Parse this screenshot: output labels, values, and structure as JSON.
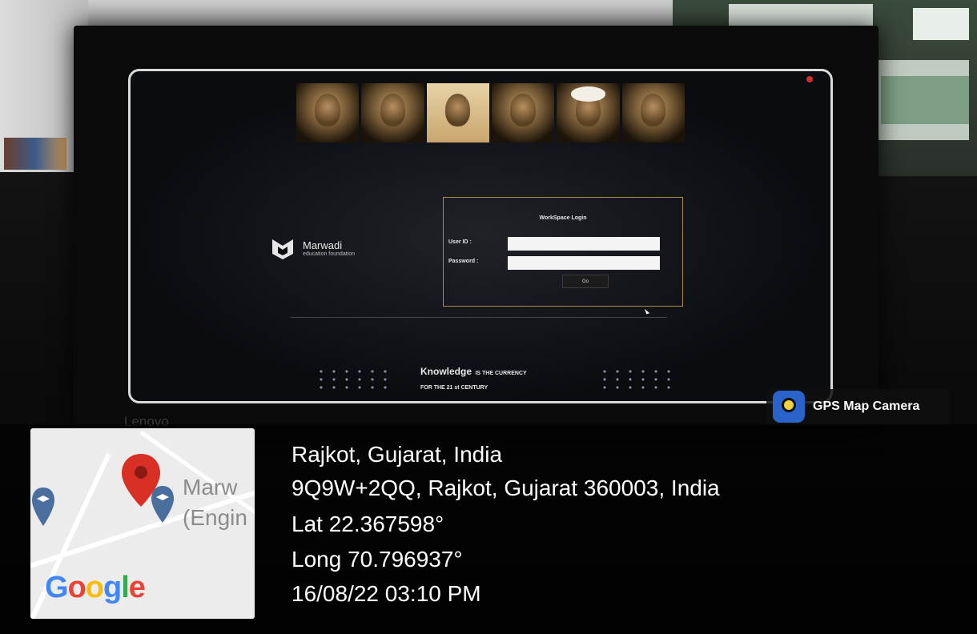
{
  "screen": {
    "workspace_title": "WorkSpace Login",
    "user_id_label": "User ID :",
    "password_label": "Password :",
    "go_button": "Go",
    "brand_name": "Marwadi",
    "brand_tagline": "education foundation",
    "slogan_highlight": "Knowledge",
    "slogan_rest": "IS THE CURRENCY",
    "slogan_line2": "FOR THE 21 st CENTURY",
    "monitor_brand": "Lenovo"
  },
  "gps": {
    "app_name": "GPS Map Camera",
    "map_label_line1": "Marw",
    "map_label_line2": "(Engin",
    "map_provider": "Google",
    "city": "Rajkot, Gujarat, India",
    "address": "9Q9W+2QQ, Rajkot, Gujarat 360003, India",
    "latitude": "Lat 22.367598°",
    "longitude": "Long 70.796937°",
    "datetime": "16/08/22 03:10 PM"
  },
  "colors": {
    "login_border": "#a88a4a",
    "pin_red": "#d93025",
    "pin_blue": "#4a6f9e"
  }
}
